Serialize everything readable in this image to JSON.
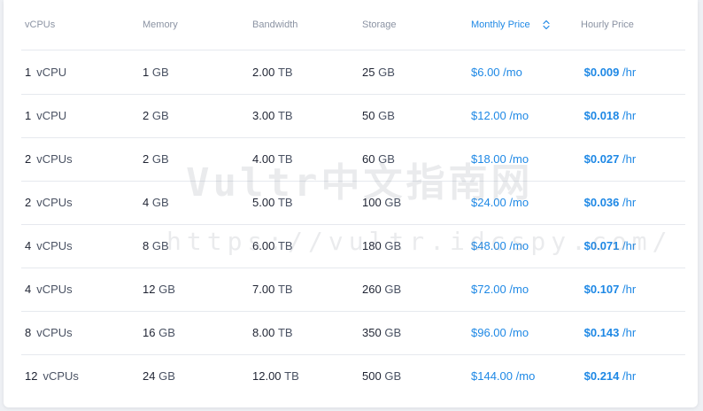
{
  "table": {
    "headers": {
      "vcpus": "vCPUs",
      "memory": "Memory",
      "bandwidth": "Bandwidth",
      "storage": "Storage",
      "monthly_price": "Monthly Price",
      "hourly_price": "Hourly Price"
    },
    "sort_column": "monthly_price",
    "sort_icon": "sort-updown-icon",
    "rows": [
      {
        "cpu_num": "1",
        "cpu_unit": "vCPU",
        "mem_num": "1",
        "mem_unit": "GB",
        "bw_num": "2.00",
        "bw_unit": "TB",
        "st_num": "25",
        "st_unit": "GB",
        "mo_num": "$6.00",
        "mo_unit": "/mo",
        "hr_num": "$0.009",
        "hr_unit": "/hr"
      },
      {
        "cpu_num": "1",
        "cpu_unit": "vCPU",
        "mem_num": "2",
        "mem_unit": "GB",
        "bw_num": "3.00",
        "bw_unit": "TB",
        "st_num": "50",
        "st_unit": "GB",
        "mo_num": "$12.00",
        "mo_unit": "/mo",
        "hr_num": "$0.018",
        "hr_unit": "/hr"
      },
      {
        "cpu_num": "2",
        "cpu_unit": "vCPUs",
        "mem_num": "2",
        "mem_unit": "GB",
        "bw_num": "4.00",
        "bw_unit": "TB",
        "st_num": "60",
        "st_unit": "GB",
        "mo_num": "$18.00",
        "mo_unit": "/mo",
        "hr_num": "$0.027",
        "hr_unit": "/hr"
      },
      {
        "cpu_num": "2",
        "cpu_unit": "vCPUs",
        "mem_num": "4",
        "mem_unit": "GB",
        "bw_num": "5.00",
        "bw_unit": "TB",
        "st_num": "100",
        "st_unit": "GB",
        "mo_num": "$24.00",
        "mo_unit": "/mo",
        "hr_num": "$0.036",
        "hr_unit": "/hr"
      },
      {
        "cpu_num": "4",
        "cpu_unit": "vCPUs",
        "mem_num": "8",
        "mem_unit": "GB",
        "bw_num": "6.00",
        "bw_unit": "TB",
        "st_num": "180",
        "st_unit": "GB",
        "mo_num": "$48.00",
        "mo_unit": "/mo",
        "hr_num": "$0.071",
        "hr_unit": "/hr"
      },
      {
        "cpu_num": "4",
        "cpu_unit": "vCPUs",
        "mem_num": "12",
        "mem_unit": "GB",
        "bw_num": "7.00",
        "bw_unit": "TB",
        "st_num": "260",
        "st_unit": "GB",
        "mo_num": "$72.00",
        "mo_unit": "/mo",
        "hr_num": "$0.107",
        "hr_unit": "/hr"
      },
      {
        "cpu_num": "8",
        "cpu_unit": "vCPUs",
        "mem_num": "16",
        "mem_unit": "GB",
        "bw_num": "8.00",
        "bw_unit": "TB",
        "st_num": "350",
        "st_unit": "GB",
        "mo_num": "$96.00",
        "mo_unit": "/mo",
        "hr_num": "$0.143",
        "hr_unit": "/hr"
      },
      {
        "cpu_num": "12",
        "cpu_unit": "vCPUs",
        "mem_num": "24",
        "mem_unit": "GB",
        "bw_num": "12.00",
        "bw_unit": "TB",
        "st_num": "500",
        "st_unit": "GB",
        "mo_num": "$144.00",
        "mo_unit": "/mo",
        "hr_num": "$0.214",
        "hr_unit": "/hr"
      }
    ]
  },
  "watermark": {
    "title": "Vultr中文指南网",
    "url": "https://vultr.idcspy.com/"
  },
  "colors": {
    "accent": "#1e88e5",
    "header_text": "#8b93a3",
    "body_text": "#1f2433",
    "divider": "#e6e9ee"
  }
}
